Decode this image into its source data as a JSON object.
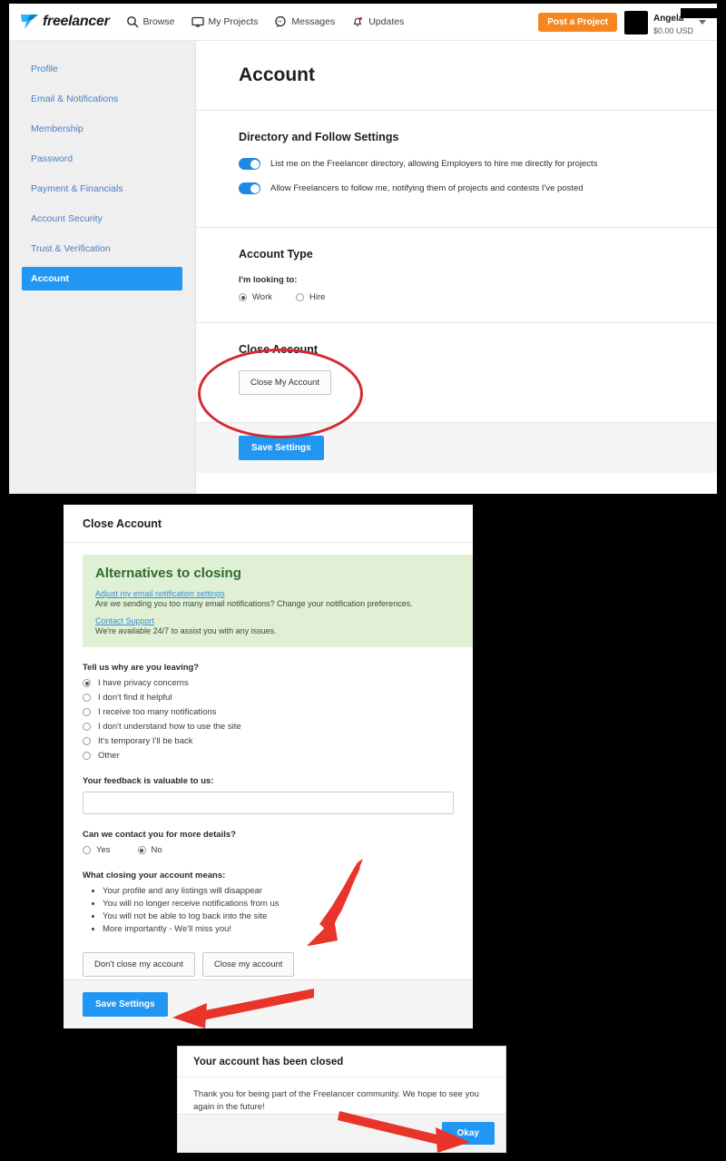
{
  "navbar": {
    "logo_text": "freelancer",
    "items": [
      {
        "label": "Browse",
        "icon": "search-icon"
      },
      {
        "label": "My Projects",
        "icon": "monitor-icon"
      },
      {
        "label": "Messages",
        "icon": "chat-icon"
      },
      {
        "label": "Updates",
        "icon": "bell-icon"
      }
    ],
    "post_project": "Post a Project",
    "user_name": "Angela",
    "user_balance": "$0.00 USD"
  },
  "sidebar": {
    "items": [
      {
        "label": "Profile",
        "active": false
      },
      {
        "label": "Email & Notifications",
        "active": false
      },
      {
        "label": "Membership",
        "active": false
      },
      {
        "label": "Password",
        "active": false
      },
      {
        "label": "Payment & Financials",
        "active": false
      },
      {
        "label": "Account Security",
        "active": false
      },
      {
        "label": "Trust & Verification",
        "active": false
      },
      {
        "label": "Account",
        "active": true
      }
    ]
  },
  "account_page": {
    "title": "Account",
    "directory": {
      "heading": "Directory and Follow Settings",
      "toggle_1_label": "List me on the Freelancer directory, allowing Employers to hire me directly for projects",
      "toggle_1_state": "on",
      "toggle_2_label": "Allow Freelancers to follow me, notifying them of projects and contests I've posted",
      "toggle_2_state": "on"
    },
    "account_type": {
      "heading": "Account Type",
      "prompt": "I'm looking to:",
      "options": [
        {
          "label": "Work",
          "selected": true
        },
        {
          "label": "Hire",
          "selected": false
        }
      ]
    },
    "close_account": {
      "heading": "Close Account",
      "button": "Close My Account"
    },
    "save_button": "Save Settings"
  },
  "close_modal": {
    "title": "Close Account",
    "alternatives": {
      "heading": "Alternatives to closing",
      "link_1": "Adjust my email notification settings",
      "desc_1": "Are we sending you too many email notifications? Change your notification preferences.",
      "link_2": "Contact Support",
      "desc_2": "We're available 24/7 to assist you with any issues."
    },
    "reason_label": "Tell us why are you leaving?",
    "reasons": [
      {
        "label": "I have privacy concerns",
        "selected": true
      },
      {
        "label": "I don't find it helpful",
        "selected": false
      },
      {
        "label": "I receive too many notifications",
        "selected": false
      },
      {
        "label": "I don't understand how to use the site",
        "selected": false
      },
      {
        "label": "It's temporary I'll be back",
        "selected": false
      },
      {
        "label": "Other",
        "selected": false
      }
    ],
    "feedback_label": "Your feedback is valuable to us:",
    "feedback_value": "",
    "feedback_placeholder": "",
    "contact_label": "Can we contact you for more details?",
    "contact_options": [
      {
        "label": "Yes",
        "selected": false
      },
      {
        "label": "No",
        "selected": true
      }
    ],
    "means_label": "What closing your account means:",
    "means_items": [
      "Your profile and any listings will disappear",
      "You will no longer receive notifications from us",
      "You will not be able to log back into the site",
      "More importantly - We'll miss you!"
    ],
    "dont_close_button": "Don't close my account",
    "close_button": "Close my account",
    "save_button": "Save Settings"
  },
  "confirmation": {
    "title": "Your account has been closed",
    "message": "Thank you for being part of the Freelancer community. We hope to see you again in the future!",
    "okay_button": "Okay"
  },
  "annotations": {
    "accent_red": "#e8342b",
    "ellipse_color": "#d42a33"
  }
}
